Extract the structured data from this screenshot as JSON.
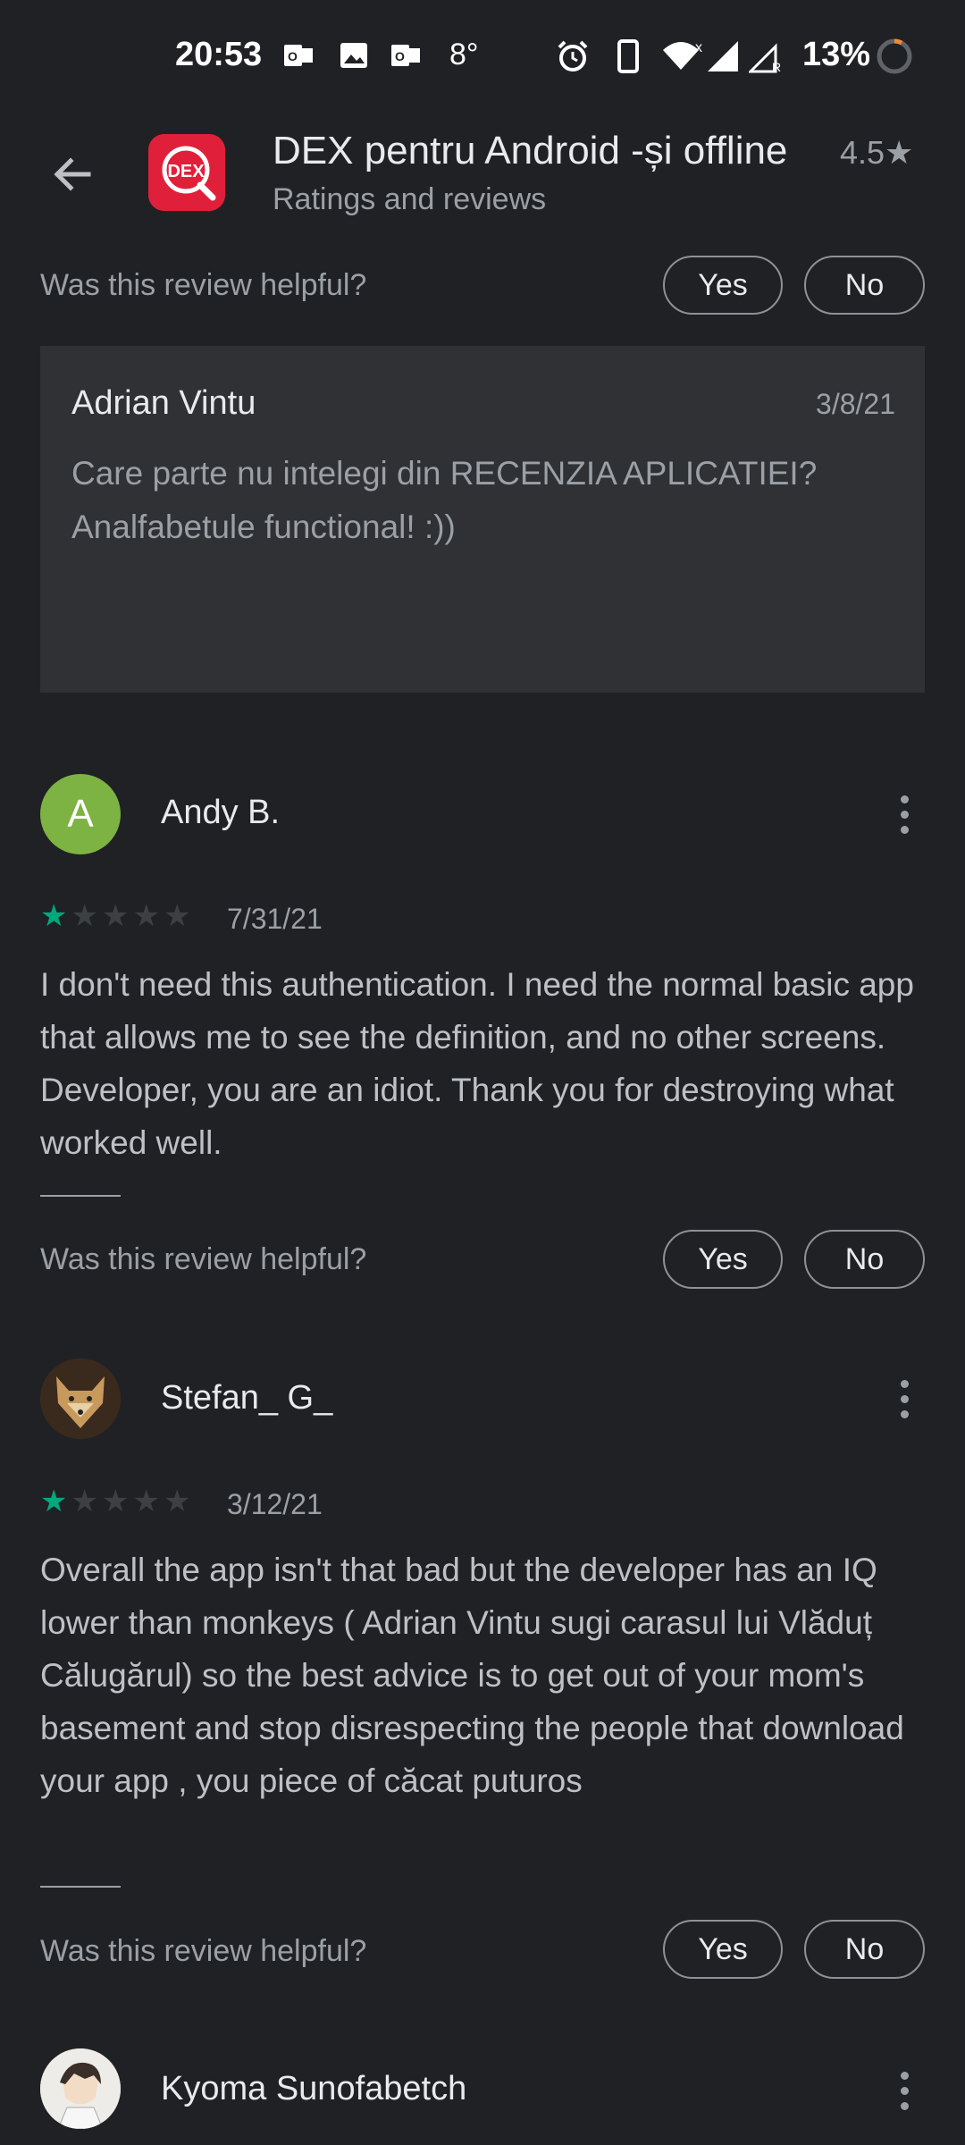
{
  "status_bar": {
    "time": "20:53",
    "temperature": "8°",
    "battery": "13%"
  },
  "app": {
    "title": "DEX pentru Android -și offline",
    "rating": "4.5★",
    "subtitle": "Ratings and reviews",
    "icon_text": "DEX"
  },
  "helpful": {
    "question": "Was this review helpful?",
    "yes": "Yes",
    "no": "No"
  },
  "developer_reply": {
    "name": "Adrian Vintu",
    "date": "3/8/21",
    "text": "Care parte nu intelegi din RECENZIA APLICATIEI? Analfabetule functional! :))"
  },
  "reviews": [
    {
      "author": "Andy B.",
      "avatar_letter": "A",
      "avatar_color": "#7cb342",
      "stars": 1,
      "date": "7/31/21",
      "text": "I don't need this authentication. I need the normal basic app that allows me to see the definition, and no other screens. Developer, you are an idiot. Thank you for destroying what worked well."
    },
    {
      "author": "Stefan_ G_",
      "stars": 1,
      "date": "3/12/21",
      "text": "Overall the app isn't that bad but the developer has an IQ lower than monkeys ( Adrian Vintu sugi carasul lui Vlăduț Călugărul) so the best advice is to get out of your mom's basement and stop disrespecting the people that download your app , you piece of căcat puturos"
    },
    {
      "author": "Kyoma Sunofabetch"
    }
  ],
  "colors": {
    "background": "#202124",
    "star_on": "#01a87e",
    "app_icon": "#e0203a"
  }
}
